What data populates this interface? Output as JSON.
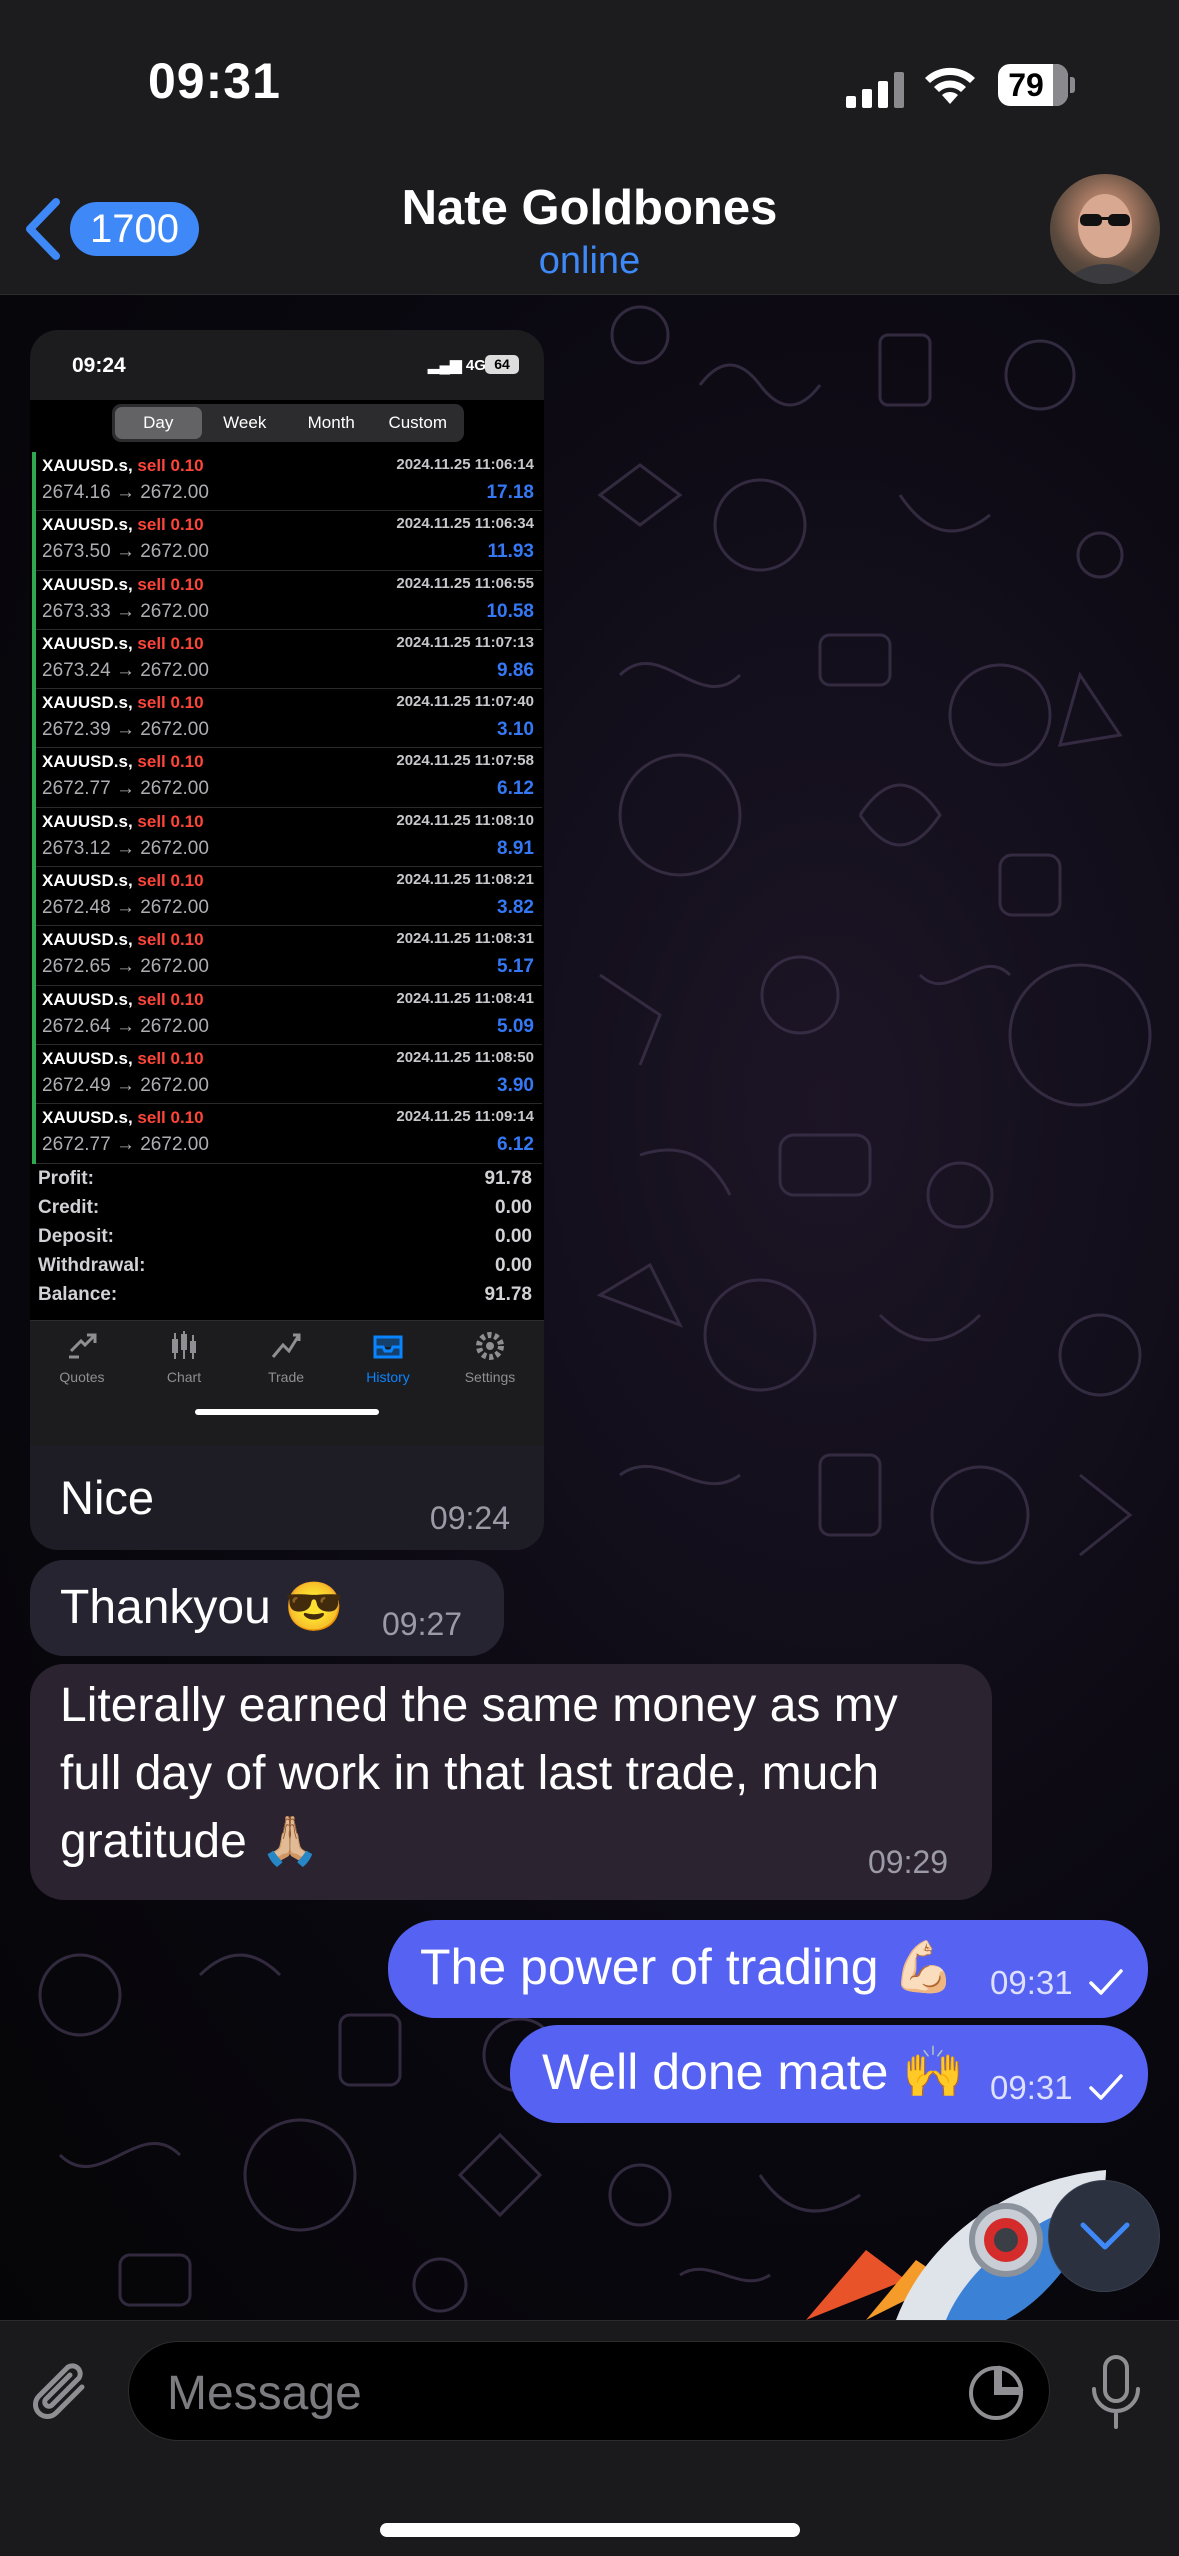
{
  "status_bar": {
    "time": "09:31",
    "battery": "79"
  },
  "header": {
    "back_count": "1700",
    "contact_name": "Nate Goldbones",
    "contact_status": "online"
  },
  "screenshot": {
    "status_time": "09:24",
    "network": "4G",
    "battery": "64",
    "period_tabs": [
      "Day",
      "Week",
      "Month",
      "Custom"
    ],
    "active_period": "Day",
    "trades": [
      {
        "symbol": "XAUUSD.s,",
        "side": "sell 0.10",
        "prices": "2674.16 → 2672.00",
        "datetime": "2024.11.25 11:06:14",
        "profit": "17.18"
      },
      {
        "symbol": "XAUUSD.s,",
        "side": "sell 0.10",
        "prices": "2673.50 → 2672.00",
        "datetime": "2024.11.25 11:06:34",
        "profit": "11.93"
      },
      {
        "symbol": "XAUUSD.s,",
        "side": "sell 0.10",
        "prices": "2673.33 → 2672.00",
        "datetime": "2024.11.25 11:06:55",
        "profit": "10.58"
      },
      {
        "symbol": "XAUUSD.s,",
        "side": "sell 0.10",
        "prices": "2673.24 → 2672.00",
        "datetime": "2024.11.25 11:07:13",
        "profit": "9.86"
      },
      {
        "symbol": "XAUUSD.s,",
        "side": "sell 0.10",
        "prices": "2672.39 → 2672.00",
        "datetime": "2024.11.25 11:07:40",
        "profit": "3.10"
      },
      {
        "symbol": "XAUUSD.s,",
        "side": "sell 0.10",
        "prices": "2672.77 → 2672.00",
        "datetime": "2024.11.25 11:07:58",
        "profit": "6.12"
      },
      {
        "symbol": "XAUUSD.s,",
        "side": "sell 0.10",
        "prices": "2673.12 → 2672.00",
        "datetime": "2024.11.25 11:08:10",
        "profit": "8.91"
      },
      {
        "symbol": "XAUUSD.s,",
        "side": "sell 0.10",
        "prices": "2672.48 → 2672.00",
        "datetime": "2024.11.25 11:08:21",
        "profit": "3.82"
      },
      {
        "symbol": "XAUUSD.s,",
        "side": "sell 0.10",
        "prices": "2672.65 → 2672.00",
        "datetime": "2024.11.25 11:08:31",
        "profit": "5.17"
      },
      {
        "symbol": "XAUUSD.s,",
        "side": "sell 0.10",
        "prices": "2672.64 → 2672.00",
        "datetime": "2024.11.25 11:08:41",
        "profit": "5.09"
      },
      {
        "symbol": "XAUUSD.s,",
        "side": "sell 0.10",
        "prices": "2672.49 → 2672.00",
        "datetime": "2024.11.25 11:08:50",
        "profit": "3.90"
      },
      {
        "symbol": "XAUUSD.s,",
        "side": "sell 0.10",
        "prices": "2672.77 → 2672.00",
        "datetime": "2024.11.25 11:09:14",
        "profit": "6.12"
      }
    ],
    "summary": [
      {
        "label": "Profit:",
        "value": "91.78"
      },
      {
        "label": "Credit:",
        "value": "0.00"
      },
      {
        "label": "Deposit:",
        "value": "0.00"
      },
      {
        "label": "Withdrawal:",
        "value": "0.00"
      },
      {
        "label": "Balance:",
        "value": "91.78"
      }
    ],
    "tabs": [
      {
        "label": "Quotes",
        "icon": "quotes-icon"
      },
      {
        "label": "Chart",
        "icon": "chart-icon"
      },
      {
        "label": "Trade",
        "icon": "trade-icon"
      },
      {
        "label": "History",
        "icon": "history-icon"
      },
      {
        "label": "Settings",
        "icon": "settings-icon"
      }
    ],
    "active_tab": "History"
  },
  "messages": [
    {
      "direction": "incoming",
      "text": "Nice",
      "time": "09:24"
    },
    {
      "direction": "incoming",
      "text": "Thankyou 😎",
      "time": "09:27"
    },
    {
      "direction": "incoming",
      "lines": [
        "Literally earned the same money as my",
        "full day of work in that last trade, much",
        "gratitude 🙏🏼"
      ],
      "time": "09:29"
    },
    {
      "direction": "outgoing",
      "text": "The power of trading 💪🏻",
      "time": "09:31",
      "status": "sent"
    },
    {
      "direction": "outgoing",
      "text": "Well done mate 🙌",
      "time": "09:31",
      "status": "sent"
    }
  ],
  "composer": {
    "placeholder": "Message"
  },
  "colors": {
    "accent": "#3e88f7",
    "outgoing_bubble": "#5562f2",
    "incoming_bubble": "#262430",
    "sell": "#ff453a",
    "profit": "#3478f6"
  }
}
